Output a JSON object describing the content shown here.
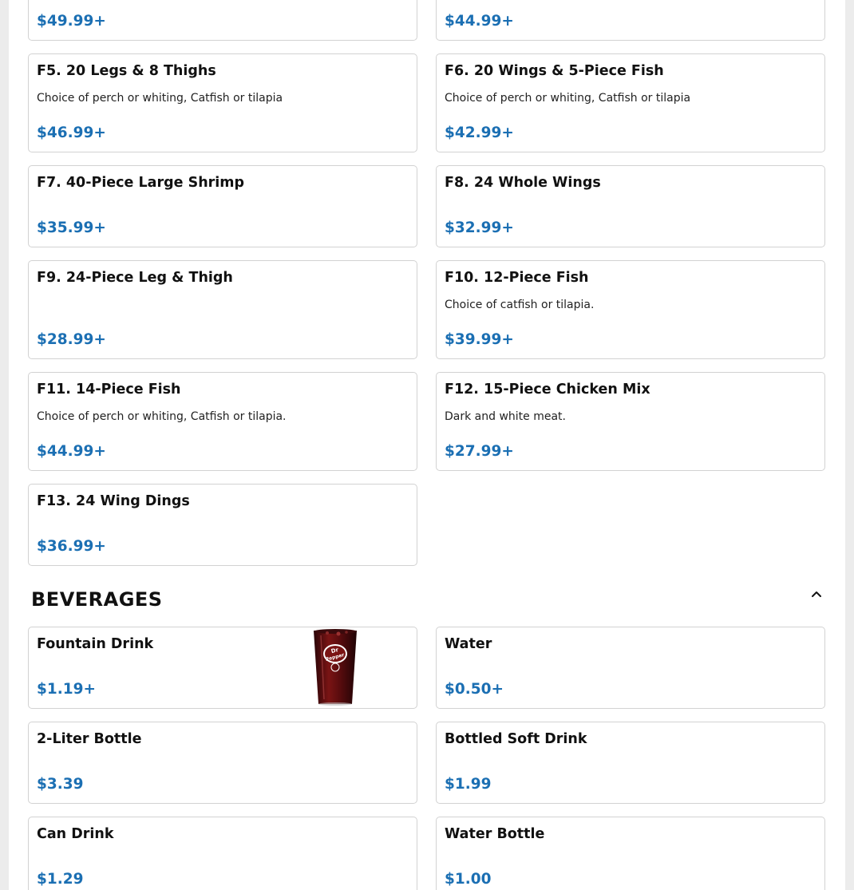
{
  "colors": {
    "price": "#1b6fb3",
    "border": "#d2d2d2",
    "background": "#ffffff",
    "page_gutter": "#ececec"
  },
  "top_items": [
    {
      "price": "$49.99+"
    },
    {
      "price": "$44.99+"
    }
  ],
  "menu_items": [
    {
      "name": "F5. 20 Legs & 8 Thighs",
      "description": "Choice of perch or whiting, Catfish or tilapia",
      "price": "$46.99+"
    },
    {
      "name": "F6. 20 Wings & 5-Piece Fish",
      "description": "Choice of perch or whiting, Catfish or tilapia",
      "price": "$42.99+"
    },
    {
      "name": "F7. 40-Piece Large Shrimp",
      "price": "$35.99+"
    },
    {
      "name": "F8. 24 Whole Wings",
      "price": "$32.99+"
    },
    {
      "name": "F9. 24-Piece Leg & Thigh",
      "description": "",
      "price": "$28.99+"
    },
    {
      "name": "F10. 12-Piece Fish",
      "description": "Choice of catfish or tilapia.",
      "price": "$39.99+"
    },
    {
      "name": "F11. 14-Piece Fish",
      "description": "Choice of perch or whiting, Catfish or tilapia.",
      "price": "$44.99+"
    },
    {
      "name": "F12. 15-Piece Chicken Mix",
      "description": "Dark and white meat.",
      "price": "$27.99+"
    },
    {
      "name": "F13. 24 Wing Dings",
      "price": "$36.99+"
    }
  ],
  "beverages": {
    "title": "BEVERAGES",
    "collapse_icon": "chevron-up-icon",
    "items": [
      {
        "name": "Fountain Drink",
        "price": "$1.19+",
        "image": "dr-pepper-cup-image"
      },
      {
        "name": "Water",
        "price": "$0.50+"
      },
      {
        "name": "2-Liter Bottle",
        "price": "$3.39"
      },
      {
        "name": "Bottled Soft Drink",
        "price": "$1.99"
      },
      {
        "name": "Can Drink",
        "price": "$1.29"
      },
      {
        "name": "Water Bottle",
        "price": "$1.00"
      }
    ]
  }
}
